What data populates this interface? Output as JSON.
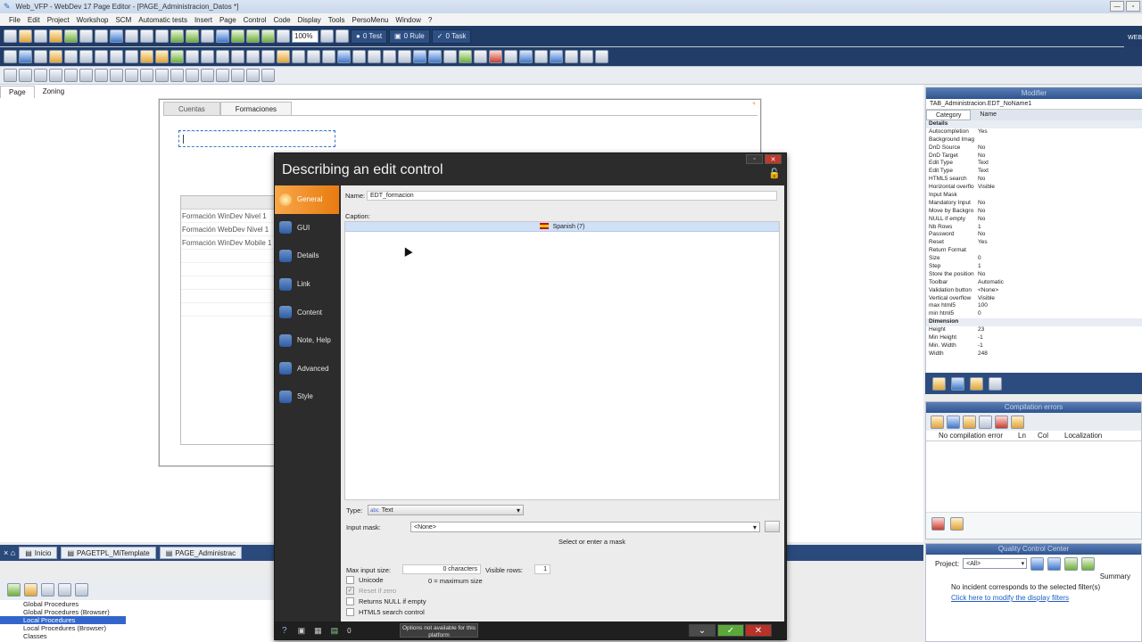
{
  "window": {
    "title": "Web_VFP - WebDev 17  Page Editor - [PAGE_Administracion_Datos *]"
  },
  "menu": [
    "File",
    "Edit",
    "Project",
    "Workshop",
    "SCM",
    "Automatic tests",
    "Insert",
    "Page",
    "Control",
    "Code",
    "Display",
    "Tools",
    "PersoMenu",
    "Window",
    "?"
  ],
  "toolbar": {
    "zoom": "100%",
    "test_label": "0 Test",
    "rule_label": "0 Rule",
    "task_label": "0 Task",
    "brand": "WEB"
  },
  "editor": {
    "tabs": [
      "Page",
      "Zoning"
    ],
    "page_tabs": [
      "Cuentas",
      "Formaciones"
    ],
    "table_rows": [
      "Formación WinDev Nivel 1",
      "Formación WebDev Nivel 1",
      "Formación WinDev Mobile 1"
    ]
  },
  "modifier": {
    "title": "Modifier",
    "control_name": "TAB_Administracion.EDT_NoName1",
    "tabs": [
      "Category",
      "Name"
    ],
    "props": [
      [
        "Details",
        ""
      ],
      [
        "Autocompletion",
        "Yes"
      ],
      [
        "Background Imag",
        ""
      ],
      [
        "DnD Source",
        "No"
      ],
      [
        "DnD Target",
        "No"
      ],
      [
        "Edit Type",
        "Text"
      ],
      [
        "Edit Type",
        "Text"
      ],
      [
        "HTML5 search",
        "No"
      ],
      [
        "Horizontal overflo",
        "Visible"
      ],
      [
        "Input Mask",
        ""
      ],
      [
        "Mandatory Input",
        "No"
      ],
      [
        "Move by Backgro",
        "No"
      ],
      [
        "NULL if empty",
        "No"
      ],
      [
        "Nb Rows",
        "1"
      ],
      [
        "Password",
        "No"
      ],
      [
        "Reset",
        "Yes"
      ],
      [
        "Return Format",
        ""
      ],
      [
        "Size",
        "0"
      ],
      [
        "Step",
        "1"
      ],
      [
        "Store the position",
        "No"
      ],
      [
        "Toolbar",
        "Automatic"
      ],
      [
        "Validation button",
        "<None>"
      ],
      [
        "Vertical overflow",
        "Visible"
      ],
      [
        "max html5",
        "100"
      ],
      [
        "min html5",
        "0"
      ],
      [
        "Dimension",
        ""
      ],
      [
        "Height",
        "23"
      ],
      [
        "Min Height",
        "-1"
      ],
      [
        "Min. Width",
        "-1"
      ],
      [
        "Width",
        "248"
      ]
    ]
  },
  "compilation": {
    "title": "Compilation errors",
    "columns": [
      "No compilation error",
      "Ln",
      "Col",
      "Localization"
    ]
  },
  "qcc": {
    "title": "Quality Control Center",
    "project_label": "Project:",
    "project_value": "<All>",
    "summary": "Summary",
    "message": "No incident corresponds to the selected filter(s)",
    "link": "Click here to modify the display filters"
  },
  "taskbar": {
    "tabs": [
      "Inicio",
      "PAGETPL_MiTemplate",
      "PAGE_Administrac"
    ]
  },
  "procedures": [
    "Global Procedures",
    "Global Procedures (Browser)",
    "Local Procedures",
    "Local Procedures (Browser)",
    "Classes"
  ],
  "dialog": {
    "title": "Describing an edit control",
    "sidebar": [
      "General",
      "GUI",
      "Details",
      "Link",
      "Content",
      "Note, Help",
      "Advanced",
      "Style"
    ],
    "name_label": "Name:",
    "name_value": "EDT_formacion",
    "caption_label": "Caption:",
    "caption_lang": "Spanish (7)",
    "type_label": "Type:",
    "type_badge": "abc",
    "type_value": "Text",
    "mask_label": "Input mask:",
    "mask_value": "<None>",
    "mask_hint": "Select or enter a mask",
    "max_label": "Max input size:",
    "max_value": "0 characters",
    "visible_rows_label": "Visible rows:",
    "visible_rows_value": "1",
    "max_hint": "0 = maximum size",
    "options": {
      "unicode": "Unicode",
      "reset_zero": "Reset if zero",
      "null_empty": "Returns NULL if empty",
      "html5": "HTML5 search control"
    },
    "footer_count": "0",
    "not_available": "Options not available for this platform"
  }
}
